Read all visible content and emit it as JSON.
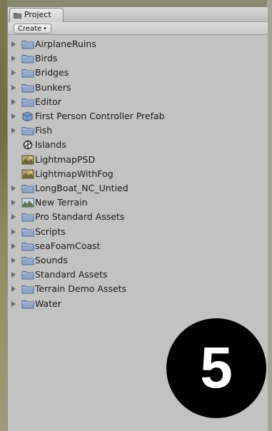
{
  "window": {
    "tab_label": "Project",
    "tab_icon": "folder-icon"
  },
  "toolbar": {
    "create_label": "Create",
    "create_caret": "▾"
  },
  "tree_items": [
    {
      "label": "AirplaneRuins",
      "icon": "folder-icon",
      "expandable": true
    },
    {
      "label": "Birds",
      "icon": "folder-icon",
      "expandable": true
    },
    {
      "label": "Bridges",
      "icon": "folder-icon",
      "expandable": true
    },
    {
      "label": "Bunkers",
      "icon": "folder-icon",
      "expandable": true
    },
    {
      "label": "Editor",
      "icon": "folder-icon",
      "expandable": true
    },
    {
      "label": "First Person Controller Prefab",
      "icon": "prefab-icon",
      "expandable": true
    },
    {
      "label": "Fish",
      "icon": "folder-icon",
      "expandable": true
    },
    {
      "label": "Islands",
      "icon": "unity-scene-icon",
      "expandable": false
    },
    {
      "label": "LightmapPSD",
      "icon": "texture-icon",
      "expandable": false
    },
    {
      "label": "LightmapWithFog",
      "icon": "texture-icon",
      "expandable": false
    },
    {
      "label": "LongBoat_NC_Untied",
      "icon": "folder-icon",
      "expandable": true
    },
    {
      "label": "New Terrain",
      "icon": "terrain-icon",
      "expandable": true
    },
    {
      "label": "Pro Standard Assets",
      "icon": "folder-icon",
      "expandable": true
    },
    {
      "label": "Scripts",
      "icon": "folder-icon",
      "expandable": true
    },
    {
      "label": "seaFoamCoast",
      "icon": "folder-icon",
      "expandable": true
    },
    {
      "label": "Sounds",
      "icon": "folder-icon",
      "expandable": true
    },
    {
      "label": "Standard Assets",
      "icon": "folder-icon",
      "expandable": true
    },
    {
      "label": "Terrain Demo Assets",
      "icon": "folder-icon",
      "expandable": true
    },
    {
      "label": "Water",
      "icon": "folder-icon",
      "expandable": true
    }
  ],
  "overlay": {
    "step_number": "5"
  },
  "colors": {
    "panel_bg": "#c2c2c2",
    "folder_fill": "#8fa8c8",
    "folder_stroke": "#4f6b8f",
    "badge_bg": "#000000"
  }
}
